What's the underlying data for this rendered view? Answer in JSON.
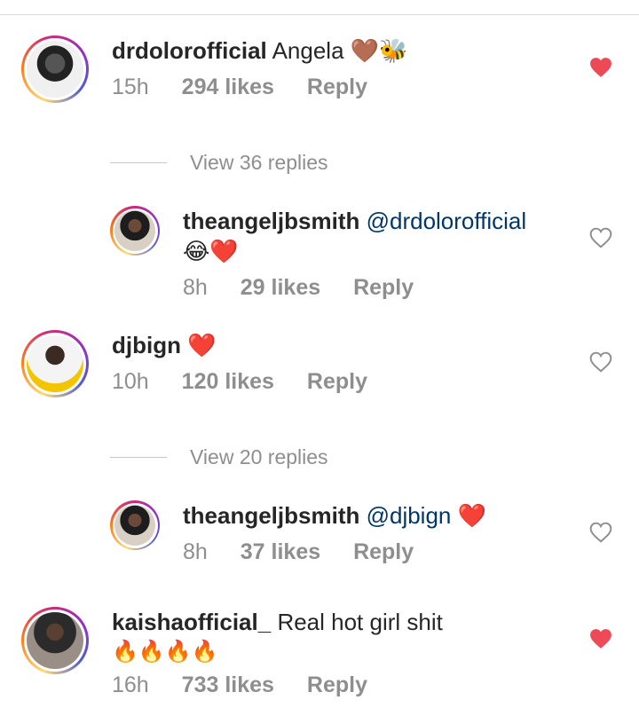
{
  "comments": [
    {
      "username": "drdolorofficial",
      "text": "Angela",
      "emoji": "🤎🐝",
      "time": "15h",
      "likes": "294 likes",
      "reply": "Reply",
      "liked": true
    },
    {
      "username": "theangeljbsmith",
      "mention": "@drdolorofficial",
      "emoji": "😂❤️",
      "time": "8h",
      "likes": "29 likes",
      "reply": "Reply",
      "liked": false
    },
    {
      "username": "djbign",
      "emoji": "❤️",
      "time": "10h",
      "likes": "120 likes",
      "reply": "Reply",
      "liked": false
    },
    {
      "username": "theangeljbsmith",
      "mention": "@djbign",
      "emoji": "❤️",
      "time": "8h",
      "likes": "37 likes",
      "reply": "Reply",
      "liked": false
    },
    {
      "username": "kaishaofficial_",
      "text": "Real hot girl shit",
      "emoji": "🔥🔥🔥🔥",
      "time": "16h",
      "likes": "733 likes",
      "reply": "Reply",
      "liked": true
    }
  ],
  "view_replies": [
    "View 36 replies",
    "View 20 replies"
  ],
  "colors": {
    "liked_heart": "#ed4956",
    "username": "#262626",
    "mention": "#00376b",
    "meta": "#8e8e8e"
  }
}
